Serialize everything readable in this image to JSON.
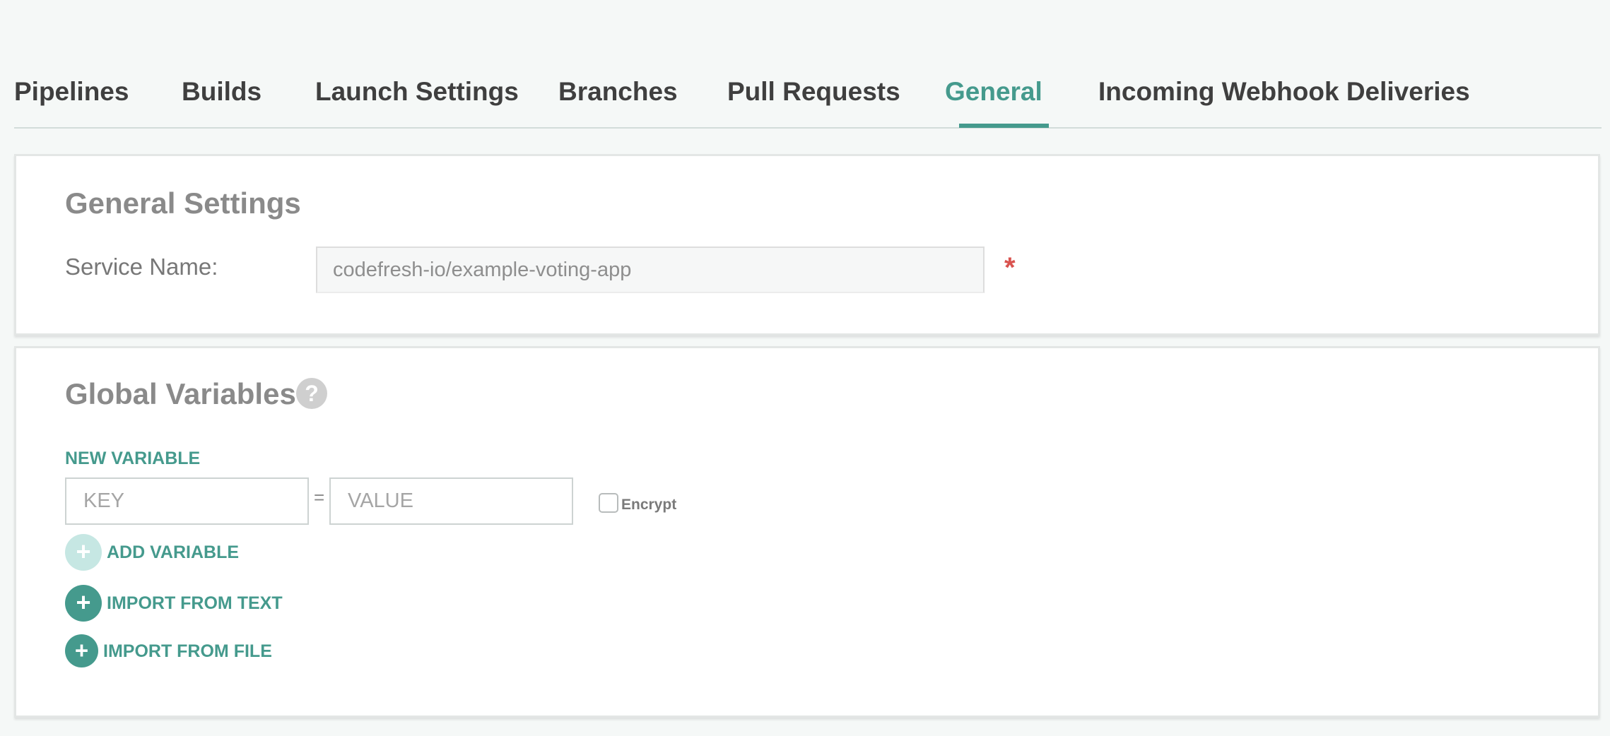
{
  "tabs": [
    {
      "label": "Pipelines",
      "active": false
    },
    {
      "label": "Builds",
      "active": false
    },
    {
      "label": "Launch Settings",
      "active": false
    },
    {
      "label": "Branches",
      "active": false
    },
    {
      "label": "Pull Requests",
      "active": false
    },
    {
      "label": "General",
      "active": true
    },
    {
      "label": "Incoming Webhook Deliveries",
      "active": false
    }
  ],
  "general_settings": {
    "title": "General Settings",
    "service_name_label": "Service Name:",
    "service_name_value": "codefresh-io/example-voting-app",
    "required_marker": "*"
  },
  "global_variables": {
    "title": "Global Variables",
    "help_icon": "question-circle-icon",
    "new_variable_label": "NEW VARIABLE",
    "key_placeholder": "KEY",
    "value_placeholder": "VALUE",
    "equals": "=",
    "encrypt_label": "Encrypt",
    "encrypt_checked": false,
    "add_variable_label": "ADD VARIABLE",
    "import_text_label": "IMPORT FROM TEXT",
    "import_file_label": "IMPORT FROM FILE",
    "plus_glyph": "+"
  },
  "colors": {
    "accent": "#459a8d",
    "accent_disabled": "#c6e7e3",
    "required": "#d9534f",
    "background": "#f5f8f7"
  }
}
